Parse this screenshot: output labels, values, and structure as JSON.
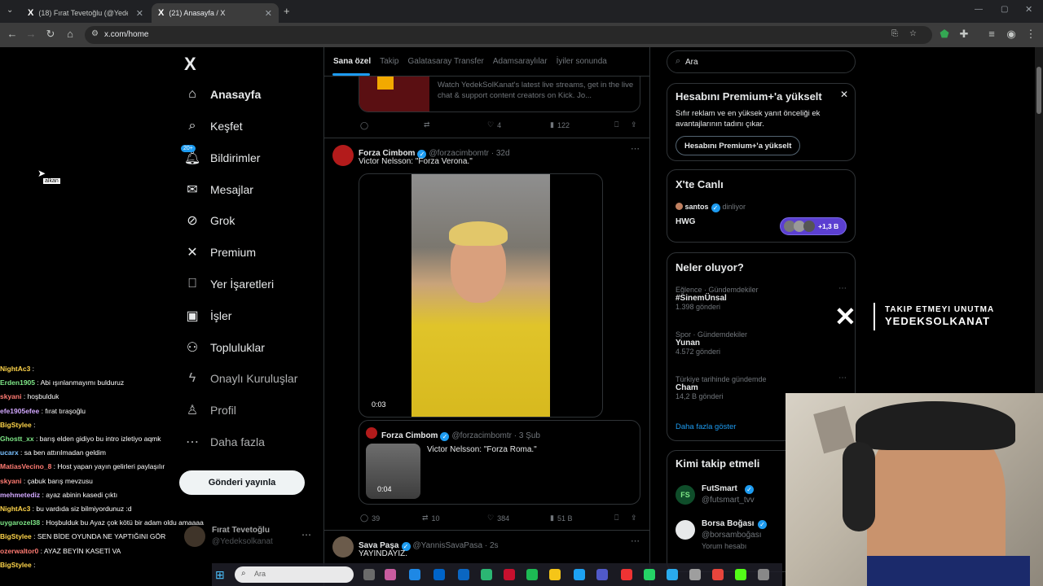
{
  "browser": {
    "tabs": [
      {
        "title": "(18) Fırat Tevetoğlu (@Yedeksol",
        "active": false
      },
      {
        "title": "(21) Anasayfa / X",
        "active": true
      }
    ],
    "new_tab": "+",
    "url": "x.com/home"
  },
  "sidebar": {
    "logo": "X",
    "items": [
      {
        "label": "Anasayfa",
        "icon": "home-icon",
        "glyph": "⌂"
      },
      {
        "label": "Keşfet",
        "icon": "search-icon",
        "glyph": "⌕"
      },
      {
        "label": "Bildirimler",
        "icon": "bell-icon",
        "glyph": "♪",
        "badge": "20+"
      },
      {
        "label": "Mesajlar",
        "icon": "mail-icon",
        "glyph": "✉"
      },
      {
        "label": "Grok",
        "icon": "grok-icon",
        "glyph": "⊘"
      },
      {
        "label": "Premium",
        "icon": "x-icon",
        "glyph": "✕"
      },
      {
        "label": "Yer İşaretleri",
        "icon": "bookmark-icon",
        "glyph": "⎕"
      },
      {
        "label": "İşler",
        "icon": "briefcase-icon",
        "glyph": "▣"
      },
      {
        "label": "Topluluklar",
        "icon": "people-icon",
        "glyph": "⚇"
      },
      {
        "label": "Onaylı Kuruluşlar",
        "icon": "lightning-icon",
        "glyph": "ϟ"
      },
      {
        "label": "Profil",
        "icon": "person-icon",
        "glyph": "♙"
      },
      {
        "label": "Daha fazla",
        "icon": "more-icon",
        "glyph": "⋯"
      }
    ],
    "post_button": "Gönderi yayınla",
    "account_name": "Fırat Tevetoğlu",
    "account_handle": "@Yedeksolkanat",
    "cursor_tooltip": "alkan"
  },
  "feed": {
    "tabs": [
      "Sana özel",
      "Takip",
      "Galatasaray Transfer",
      "Adamsaraylılar",
      "İyiler sonunda"
    ],
    "kick_card_text": "Watch YedekSolKanat's latest live streams, get in the live chat & support content creators on Kick. Jo...",
    "post0_actions": {
      "likes": "4",
      "views": "122"
    },
    "post1": {
      "name": "Forza Cimbom",
      "handle": "@forzacimbomtr",
      "time": "32d",
      "text": "Victor Nelsson: \"Forza Verona.\"",
      "video_time": "0:03",
      "quote": {
        "name": "Forza Cimbom",
        "handle": "@forzacimbomtr",
        "time": "3 Şub",
        "text": "Victor Nelsson: \"Forza Roma.\"",
        "video_time": "0:04"
      },
      "replies": "39",
      "reposts": "10",
      "likes": "384",
      "views": "51 B"
    },
    "post2": {
      "name": "Sava Paşa",
      "handle": "@YannisSavaPasa",
      "time": "2s",
      "text": "YAYINDAYIZ."
    }
  },
  "right": {
    "search_placeholder": "Ara",
    "premium": {
      "title": "Hesabını Premium+'a yükselt",
      "body": "Sıfır reklam ve en yüksek yanıt önceliği ek avantajlarının tadını çıkar.",
      "button": "Hesabını Premium+'a yükselt"
    },
    "live": {
      "title": "X'te Canlı",
      "host": "santos",
      "status": "dinliyor",
      "space": "HWG",
      "listeners": "+1,3 B"
    },
    "trends": {
      "title": "Neler oluyor?",
      "items": [
        {
          "category": "Eğlence · Gündemdekiler",
          "name": "#SinemÜnsal",
          "count": "1.398 gönderi"
        },
        {
          "category": "Spor · Gündemdekiler",
          "name": "Yunan",
          "count": "4.572 gönderi"
        },
        {
          "category": "Türkiye tarihinde gündemde",
          "name": "Cham",
          "count": "14,2 B gönderi"
        }
      ],
      "more": "Daha fazla göster"
    },
    "follow": {
      "title": "Kimi takip etmeli",
      "items": [
        {
          "name": "FutSmart",
          "handle": "@futsmart_tvv"
        },
        {
          "name": "Borsa Boğası",
          "handle": "@borsamboğası",
          "note": "Yorum hesabı"
        }
      ]
    }
  },
  "overlay": {
    "line1": "TAKIP ETMEYI UNUTMA",
    "line2": "YEDEKSOLKANAT"
  },
  "chat": [
    {
      "user": "NightAc3",
      "msg": "",
      "color": "#ffd54a"
    },
    {
      "user": "Erden1905",
      "msg": "Abi ışınlanmayımı bulduruz",
      "color": "#7ee787"
    },
    {
      "user": "skyani",
      "msg": "hoşbulduk",
      "color": "#ff7b72"
    },
    {
      "user": "efe1905efee",
      "msg": "fırat tıraşoğlu",
      "color": "#d2a8ff"
    },
    {
      "user": "BigStylee",
      "msg": "",
      "color": "#ffd54a"
    },
    {
      "user": "Ghostt_xx",
      "msg": "barış elden gidiyo bu intro izletiyo aqmk",
      "color": "#7ee787"
    },
    {
      "user": "ucarx",
      "msg": "sa ben attırılmadan geldim",
      "color": "#79c0ff"
    },
    {
      "user": "MatiasVecino_8",
      "msg": "Host yapan yayın gelirleri paylaşılır",
      "color": "#ff7b72"
    },
    {
      "user": "skyani",
      "msg": "çabuk barış mevzusu",
      "color": "#ff7b72"
    },
    {
      "user": "mehmetediz",
      "msg": "ayaz abinin kasedi çıktı",
      "color": "#d2a8ff"
    },
    {
      "user": "NightAc3",
      "msg": "bu vardıda siz bilmiyordunuz :d",
      "color": "#ffd54a"
    },
    {
      "user": "uygarozel38",
      "msg": "Hoşbulduk bu Ayaz çok kötü bir adam oldu amaaaa",
      "color": "#7ee787"
    },
    {
      "user": "BigStylee",
      "msg": "SEN BİDE OYUNDA NE YAPTIĞINI GÖR",
      "color": "#ffd54a"
    },
    {
      "user": "ozerwaltor0",
      "msg": "AYAZ BEYİN KASETİ VA",
      "color": "#ff7b72"
    },
    {
      "user": "BigStylee",
      "msg": "",
      "color": "#ffd54a"
    }
  ],
  "taskbar": {
    "search_placeholder": "Ara"
  }
}
